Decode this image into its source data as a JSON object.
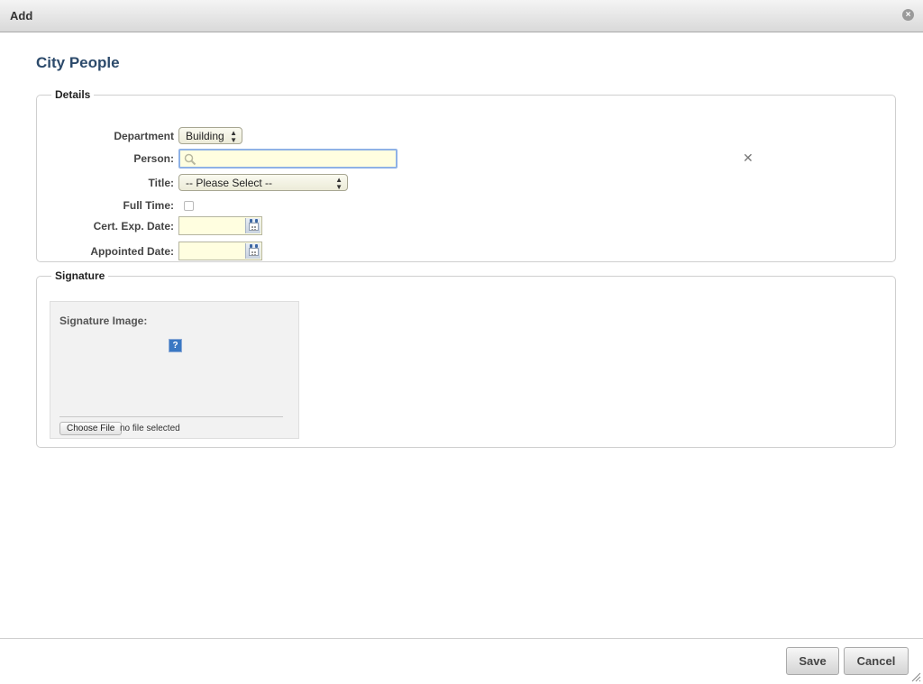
{
  "dialog": {
    "title": "Add"
  },
  "page": {
    "title": "City People"
  },
  "details": {
    "legend": "Details",
    "department": {
      "label": "Department",
      "value": "Building"
    },
    "person": {
      "label": "Person:",
      "value": ""
    },
    "title": {
      "label": "Title:",
      "value": "-- Please Select --"
    },
    "full_time": {
      "label": "Full Time:",
      "checked": false
    },
    "cert_exp_date": {
      "label": "Cert. Exp. Date:",
      "value": ""
    },
    "appointed_date": {
      "label": "Appointed Date:",
      "value": ""
    }
  },
  "signature": {
    "legend": "Signature",
    "image_label": "Signature Image:",
    "placeholder_icon": "?",
    "choose_file": "Choose File",
    "no_file": "no file selected"
  },
  "footer": {
    "save": "Save",
    "cancel": "Cancel"
  },
  "icons": {
    "close": "close-icon",
    "search": "search-icon",
    "clear": "clear-x-icon",
    "calendar": "calendar-icon",
    "broken_image": "broken-image-icon",
    "resize": "resize-grip-icon"
  },
  "colors": {
    "title_blue": "#2c4a6b",
    "input_bg": "#fffee0",
    "focus_border": "#8fb2e6"
  }
}
